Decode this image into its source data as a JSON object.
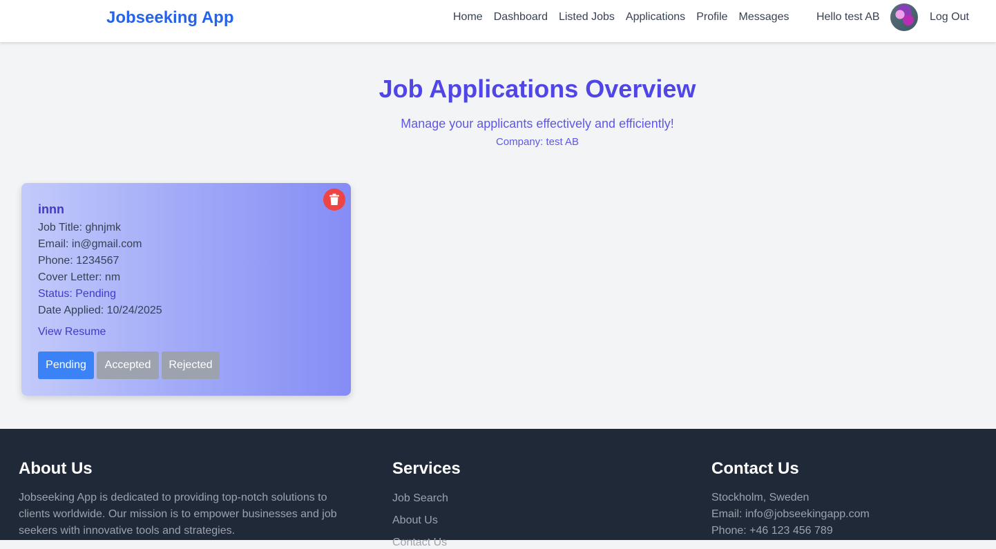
{
  "header": {
    "brand": "Jobseeking App",
    "nav": [
      "Home",
      "Dashboard",
      "Listed Jobs",
      "Applications",
      "Profile",
      "Messages"
    ],
    "greeting": "Hello test AB",
    "logout": "Log Out"
  },
  "hero": {
    "title": "Job Applications Overview",
    "subtitle": "Manage your applicants effectively and efficiently!",
    "company": "Company: test AB"
  },
  "application": {
    "name": "innn",
    "job_title": "Job Title: ghnjmk",
    "email": "Email: in@gmail.com",
    "phone": "Phone: 1234567",
    "cover_letter": "Cover Letter: nm",
    "status": "Status: Pending",
    "date_applied": "Date Applied: 10/24/2025",
    "resume_link": "View Resume",
    "buttons": {
      "pending": "Pending",
      "accepted": "Accepted",
      "rejected": "Rejected"
    }
  },
  "footer": {
    "about": {
      "title": "About Us",
      "line1": "Jobseeking App is dedicated to providing top-notch solutions to",
      "line2": "clients worldwide. Our mission is to empower businesses and job",
      "line3": "seekers with innovative tools and strategies."
    },
    "services": {
      "title": "Services",
      "links": [
        "Job Search",
        "About Us",
        "Contact Us"
      ]
    },
    "contact": {
      "title": "Contact Us",
      "location": "Stockholm, Sweden",
      "email": "Email: info@jobseekingapp.com",
      "phone": "Phone: +46 123 456 789"
    }
  },
  "colors": {
    "brand": "#2563eb",
    "accent": "#4f46e5",
    "delete": "#ef4444",
    "active_status": "#3b82f6",
    "inactive_status": "#9ca3af",
    "footer_bg": "#1f2937"
  }
}
